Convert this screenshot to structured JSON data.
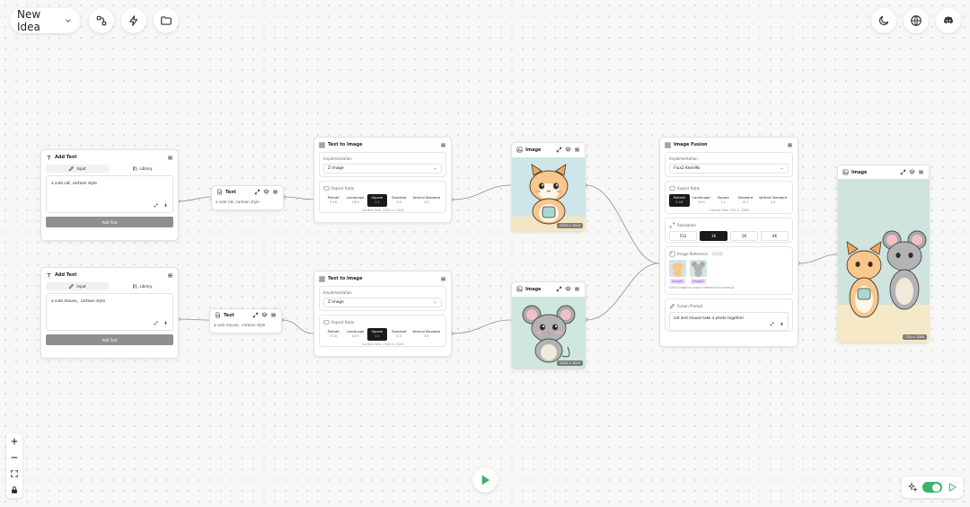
{
  "topbar": {
    "project_title": "New Idea"
  },
  "add_text_nodes": [
    {
      "title": "Add Text",
      "tab_input": "Input",
      "tab_library": "Library",
      "value": "a cute cat, cartoon style",
      "button": "Add Text"
    },
    {
      "title": "Add Text",
      "tab_input": "Input",
      "tab_library": "Library",
      "value": "a cute mouse，cartoon style",
      "button": "Add Text"
    }
  ],
  "text_nodes": [
    {
      "title": "Text",
      "value": "a cute cat, cartoon style"
    },
    {
      "title": "Text",
      "value": "a cute mouse，cartoon style"
    }
  ],
  "t2i_nodes": [
    {
      "title": "Text to Image",
      "impl_label": "Implementation",
      "impl_value": "Z Image",
      "aspect_label": "Aspect Ratio",
      "ratios": [
        {
          "name": "Portrait",
          "value": "9:16"
        },
        {
          "name": "Landscape",
          "value": "16:9"
        },
        {
          "name": "Square",
          "value": "1:1"
        },
        {
          "name": "Standard",
          "value": "4:3"
        },
        {
          "name": "Vertical Standard",
          "value": "3:4"
        }
      ],
      "active_ratio": 2,
      "current_size": "Current Size: 1024 × 1024"
    },
    {
      "title": "Text to Image",
      "impl_label": "Implementation",
      "impl_value": "Z Image",
      "aspect_label": "Aspect Ratio",
      "ratios": [
        {
          "name": "Portrait",
          "value": "9:16"
        },
        {
          "name": "Landscape",
          "value": "16:9"
        },
        {
          "name": "Square",
          "value": "1:1"
        },
        {
          "name": "Standard",
          "value": "4:3"
        },
        {
          "name": "Vertical Standard",
          "value": "3:4"
        }
      ],
      "active_ratio": 2,
      "current_size": "Current Size: 1024 × 1024"
    }
  ],
  "image_nodes": [
    {
      "title": "Image",
      "size": "1024 × 1024"
    },
    {
      "title": "Image",
      "size": "1024 × 1024"
    },
    {
      "title": "Image",
      "size": "720 × 1280"
    }
  ],
  "fusion": {
    "title": "Image Fusion",
    "impl_label": "Implementation",
    "impl_value": "Flux2 Klein9b",
    "aspect_label": "Aspect Ratio",
    "ratios": [
      {
        "name": "Portrait",
        "value": "9:16"
      },
      {
        "name": "Landscape",
        "value": "16:9"
      },
      {
        "name": "Square",
        "value": "1:1"
      },
      {
        "name": "Standard",
        "value": "4:3"
      },
      {
        "name": "Vertical Standard",
        "value": "3:4"
      }
    ],
    "current_size": "Current Size: 720 × 1280",
    "resolution_label": "Resolution",
    "resolutions": [
      "512",
      "1K",
      "2K",
      "4K"
    ],
    "ref_label": "Image Reference",
    "ref_count": "(2/16)",
    "ref_tags": [
      "image1",
      "image2"
    ],
    "ref_hint": "Click image to insert reference in prompt",
    "prompt_label": "Fusion Prompt",
    "prompt_value": "cat and mouse take a photo together"
  },
  "colors": {
    "accent_green": "#3bb46a",
    "tag_purple": "#e9dcfb",
    "image_bg_blue": "#cfe6e8",
    "image_bg_green": "#cfe7dc",
    "image_bg_cream": "#f6e9c7"
  }
}
